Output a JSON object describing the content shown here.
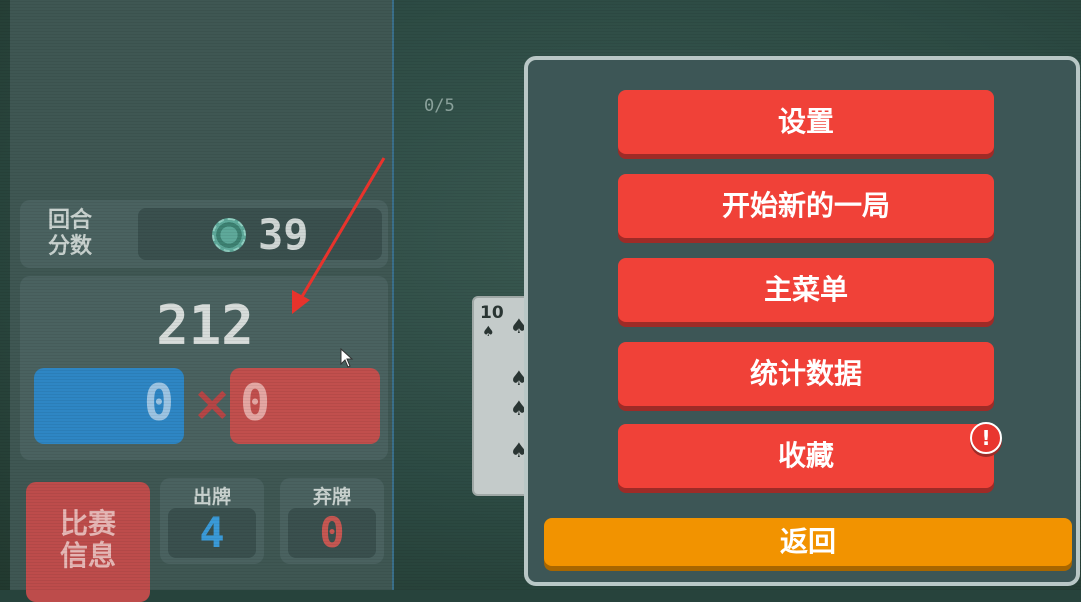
{
  "hud": {
    "round_label": "回合\n分数",
    "round_value": "39",
    "total_score": "212",
    "chips": "0",
    "mult_sign": "×",
    "mult": "0",
    "match_info": "比赛\n信息",
    "hands_label": "出牌",
    "hands_value": "4",
    "discards_label": "弃牌",
    "discards_value": "0"
  },
  "table": {
    "deck_count": "0/5",
    "card_rank": "10"
  },
  "menu": {
    "items": [
      {
        "label": "设置"
      },
      {
        "label": "开始新的一局"
      },
      {
        "label": "主菜单"
      },
      {
        "label": "统计数据"
      },
      {
        "label": "收藏"
      }
    ],
    "alert": "!",
    "back": "返回"
  },
  "colors": {
    "menu_button": "#f04138",
    "back_button": "#f29300",
    "chips": "#2e86c4",
    "mult": "#c14f4d",
    "hands_value": "#3a9ad8",
    "discards_value": "#c65752"
  }
}
